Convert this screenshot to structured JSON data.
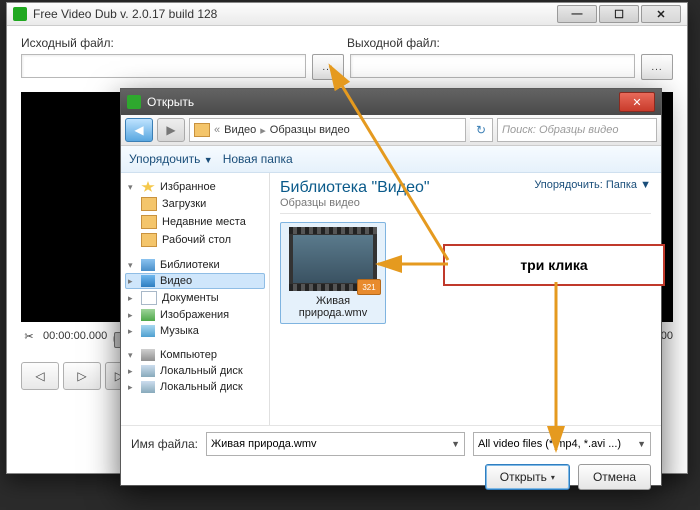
{
  "main": {
    "title": "Free Video Dub  v. 2.0.17 build 128",
    "source_label": "Исходный файл:",
    "output_label": "Выходной файл:",
    "browse_glyph": "...",
    "time_start": "00:00:00.000",
    "time_end": "00:00:00.000"
  },
  "dialog": {
    "title": "Открыть",
    "breadcrumb": {
      "root": "Видео",
      "folder": "Образцы видео"
    },
    "search_placeholder": "Поиск: Образцы видео",
    "organize": "Упорядочить",
    "new_folder": "Новая папка",
    "lib_title": "Библиотека \"Видео\"",
    "lib_subtitle": "Образцы видео",
    "sort_label": "Упорядочить:",
    "sort_value": "Папка",
    "tree": {
      "favorites": "Избранное",
      "downloads": "Загрузки",
      "recent": "Недавние места",
      "desktop": "Рабочий стол",
      "libraries": "Библиотеки",
      "video": "Видео",
      "documents": "Документы",
      "images": "Изображения",
      "music": "Музыка",
      "computer": "Компьютер",
      "localdisk": "Локальный диск",
      "localdisk2": "Локальный диск"
    },
    "file_name": "Живая природа.wmv",
    "file_badge": "321",
    "filename_label": "Имя файла:",
    "filename_value": "Живая природа.wmv",
    "filter": "All video files (*.mp4, *.avi ...)",
    "open_btn": "Открыть",
    "cancel_btn": "Отмена"
  },
  "annotation": {
    "label": "три клика"
  }
}
